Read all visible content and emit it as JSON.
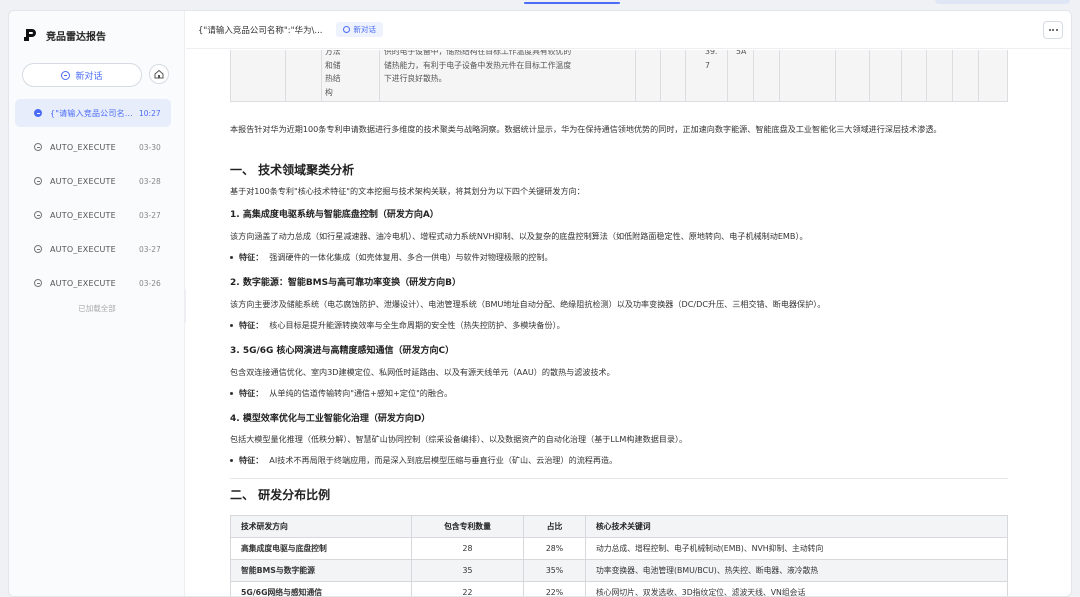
{
  "sidebar": {
    "brand": "竞品雷达报告",
    "new_chat": "新对话",
    "history": [
      {
        "title": "{\"请输入竞品公司名称\":\"华为\"...",
        "date": "10:27",
        "active": true
      },
      {
        "title": "AUTO_EXECUTE",
        "date": "03-30",
        "active": false
      },
      {
        "title": "AUTO_EXECUTE",
        "date": "03-28",
        "active": false
      },
      {
        "title": "AUTO_EXECUTE",
        "date": "03-27",
        "active": false
      },
      {
        "title": "AUTO_EXECUTE",
        "date": "03-27",
        "active": false
      },
      {
        "title": "AUTO_EXECUTE",
        "date": "03-26",
        "active": false
      }
    ],
    "loaded_all": "已加载全部"
  },
  "header": {
    "title": "{\"请输入竞品公司名称\":\"华为\\...",
    "tag": "新对话"
  },
  "top_table": {
    "c1": [
      "方法",
      "和储",
      "热结",
      "构"
    ],
    "c2": [
      "供的电子设备中，储热结构在目标工作温度具有较优的",
      "储热能力，有利于电子设备中发热元件在目标工作温度",
      "下进行良好散热。"
    ],
    "c3": [
      "39.",
      "7"
    ],
    "c4": [
      "5A"
    ]
  },
  "report": {
    "intro": "本报告针对华为近期100条专利申请数据进行多维度的技术聚类与战略洞察。数据统计显示，华为在保持通信领地优势的同时，正加速向数字能源、智能底盘及工业智能化三大领域进行深层技术渗透。",
    "sec1_title": "一、 技术领域聚类分析",
    "sec1_intro": "基于对100条专利\"核心技术特征\"的文本挖掘与技术架构关联，将其划分为以下四个关键研发方向：",
    "directions": [
      {
        "title": "1. 高集成度电驱系统与智能底盘控制（研发方向A）",
        "desc": "该方向涵盖了动力总成（如行星减速器、油冷电机）、增程式动力系统NVH抑制、以及复杂的底盘控制算法（如低附路面稳定性、原地转向、电子机械制动EMB）。",
        "feature_label": "特征：",
        "feature": "强调硬件的一体化集成（如壳体复用、多合一供电）与软件对物理极限的控制。"
      },
      {
        "title": "2. 数字能源：智能BMS与高可靠功率变换（研发方向B）",
        "desc": "该方向主要涉及储能系统（电芯腐蚀防护、泄爆设计）、电池管理系统（BMU地址自动分配、绝缘阻抗检测）以及功率变换器（DC/DC升压、三相交错、断电器保护）。",
        "feature_label": "特征：",
        "feature": "核心目标是提升能源转换效率与全生命周期的安全性（热失控防护、多模块备份）。"
      },
      {
        "title": "3. 5G/6G 核心网演进与高精度感知通信（研发方向C）",
        "desc": "包含双连接通信优化、室内3D建模定位、私网低时延路由、以及有源天线单元（AAU）的散热与滤波技术。",
        "feature_label": "特征：",
        "feature": "从单纯的信道传输转向\"通信+感知+定位\"的融合。"
      },
      {
        "title": "4. 模型效率优化与工业智能化治理（研发方向D）",
        "desc": "包括大模型量化推理（低秩分解）、智慧矿山协同控制（综采设备编排）、以及数据资产的自动化治理（基于LLM构建数据目录）。",
        "feature_label": "特征：",
        "feature": "AI技术不再局限于终端应用，而是深入到底层模型压缩与垂直行业（矿山、云治理）的流程再造。"
      }
    ],
    "sec2_title": "二、 研发分布比例",
    "table": {
      "headers": [
        "技术研发方向",
        "包含专利数量",
        "占比",
        "核心技术关键词"
      ],
      "rows": [
        [
          "高集成度电驱与底盘控制",
          "28",
          "28%",
          "动力总成、增程控制、电子机械制动(EMB)、NVH抑制、主动转向"
        ],
        [
          "智能BMS与数字能源",
          "35",
          "35%",
          "功率变换器、电池管理(BMU/BCU)、热失控、断电器、液冷散热"
        ],
        [
          "5G/6G网络与感知通信",
          "22",
          "22%",
          "核心网切片、双发选收、3D指纹定位、滤波天线、VN组会话"
        ]
      ]
    }
  }
}
